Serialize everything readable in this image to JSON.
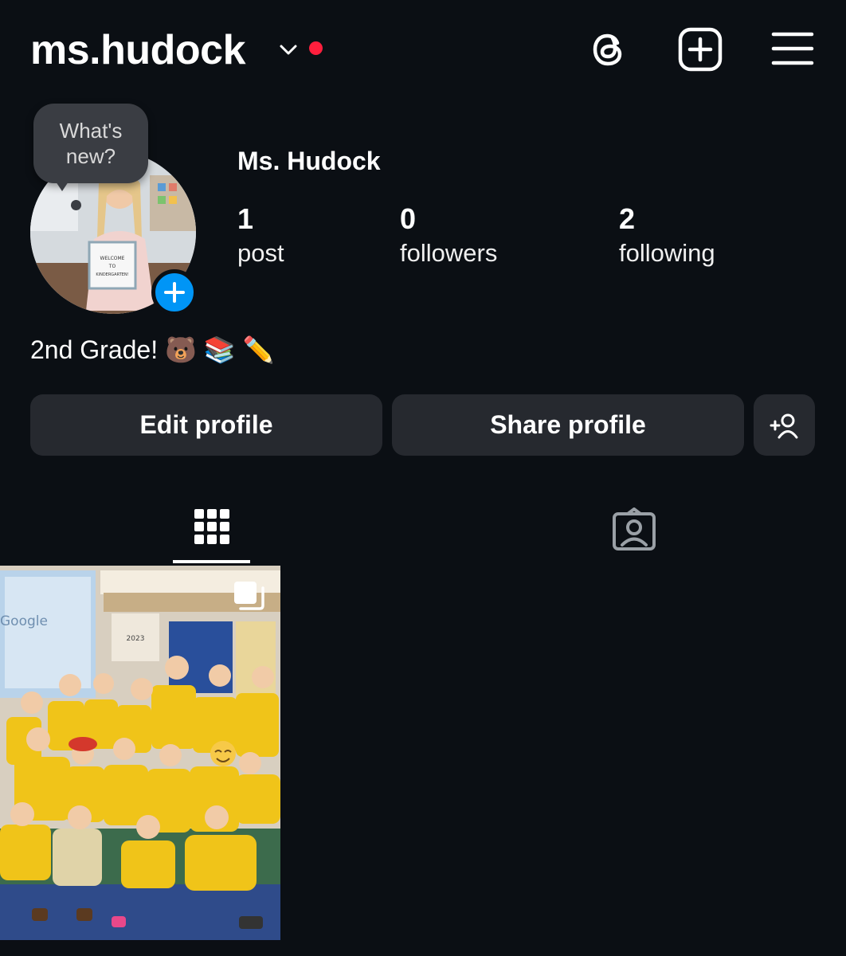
{
  "header": {
    "username": "ms.hudock",
    "icons": [
      "chevron-down-icon",
      "threads-icon",
      "new-post-icon",
      "menu-icon"
    ],
    "notification_color": "#ff1f3d"
  },
  "profile": {
    "note_bubble": "What's new?",
    "full_name": "Ms. Hudock",
    "avatar_sign": "WELCOME TO KINDERGARTEN!",
    "stats": [
      {
        "value": "1",
        "label": "post"
      },
      {
        "value": "0",
        "label": "followers"
      },
      {
        "value": "2",
        "label": "following"
      }
    ],
    "bio": "2nd Grade! 🐻 📚 ✏️"
  },
  "actions": {
    "edit_label": "Edit profile",
    "share_label": "Share profile",
    "add_person_icon": "add-person-icon"
  },
  "tabs": [
    {
      "name": "grid",
      "icon": "grid-icon",
      "active": true
    },
    {
      "name": "tagged",
      "icon": "tagged-icon",
      "active": false
    }
  ],
  "posts": [
    {
      "type": "carousel",
      "subject": "class-photo-yellow-shirts",
      "screen_text": "Google",
      "board_text": "2023"
    }
  ],
  "colors": {
    "background": "#0b0f14",
    "button_bg": "#26292f",
    "accent_blue": "#0095f6",
    "text": "#ffffff"
  }
}
